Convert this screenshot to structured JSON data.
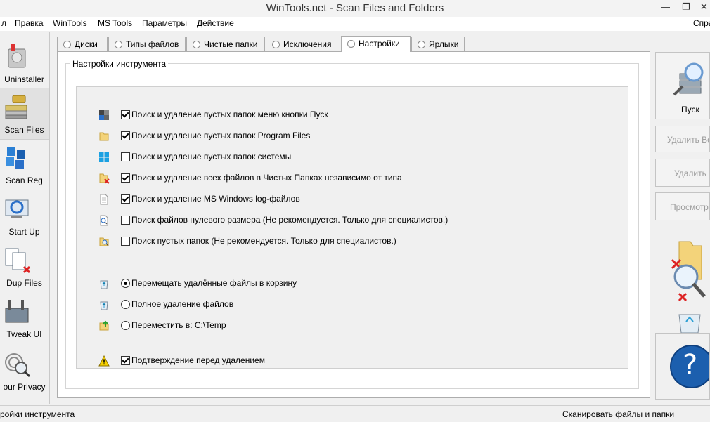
{
  "window": {
    "title": "WinTools.net - Scan Files and Folders",
    "controls": {
      "minimize": "—",
      "restore": "❐",
      "close": "✕"
    }
  },
  "menu": {
    "items": [
      "л",
      "Правка",
      "WinTools",
      "MS Tools",
      "Параметры",
      "Действие"
    ],
    "right": "Спра"
  },
  "sidebar": {
    "items": [
      {
        "label": "Uninstaller",
        "icon": "uninstaller-icon"
      },
      {
        "label": "Scan Files",
        "icon": "scan-files-icon",
        "active": true
      },
      {
        "label": "Scan Reg",
        "icon": "scan-reg-icon"
      },
      {
        "label": "Start Up",
        "icon": "startup-icon"
      },
      {
        "label": "Dup Files",
        "icon": "dup-files-icon"
      },
      {
        "label": "Tweak UI",
        "icon": "tweak-ui-icon"
      },
      {
        "label": "our Privacy",
        "icon": "privacy-icon"
      }
    ]
  },
  "tabs": [
    {
      "label": "Диски"
    },
    {
      "label": "Типы файлов"
    },
    {
      "label": "Чистые папки"
    },
    {
      "label": "Исключения"
    },
    {
      "label": "Настройки",
      "active": true
    },
    {
      "label": "Ярлыки"
    }
  ],
  "settings": {
    "group_title": "Настройки инструмента",
    "checkboxes": [
      {
        "label": "Поиск и удаление пустых папок меню кнопки Пуск",
        "checked": true,
        "icon": "start-menu-icon"
      },
      {
        "label": "Поиск и удаление пустых папок Program Files",
        "checked": true,
        "icon": "folder-icon"
      },
      {
        "label": "Поиск и удаление пустых папок системы",
        "checked": false,
        "icon": "windows-logo-icon"
      },
      {
        "label": "Поиск и удаление всех файлов в Чистых Папках независимо от типа",
        "checked": true,
        "icon": "folder-delete-icon"
      },
      {
        "label": "Поиск и удаление MS Windows log-файлов",
        "checked": true,
        "icon": "document-icon"
      },
      {
        "label": "Поиск файлов нулевого размера (Не рекомендуется. Только для специалистов.)",
        "checked": false,
        "icon": "file-search-icon"
      },
      {
        "label": "Поиск пустых папок (Не рекомендуется. Только для специалистов.)",
        "checked": false,
        "icon": "folder-search-icon"
      }
    ],
    "radios": [
      {
        "label": "Перемещать удалённые файлы в корзину",
        "checked": true,
        "icon": "recycle-bin-icon"
      },
      {
        "label": "Полное удаление файлов",
        "checked": false,
        "icon": "recycle-bin-icon"
      },
      {
        "label": "Переместить в: C:\\Temp",
        "checked": false,
        "icon": "move-folder-icon"
      }
    ],
    "confirm": {
      "label": "Подтверждение перед удалением",
      "checked": true,
      "icon": "warning-icon"
    }
  },
  "actions": {
    "start": "Пуск",
    "delete_all": "Удалить Вс",
    "delete": "Удалить",
    "view": "Просмотр",
    "help": "?"
  },
  "status": {
    "left": "ройки инструмента",
    "right": "Сканировать файлы и папки"
  }
}
